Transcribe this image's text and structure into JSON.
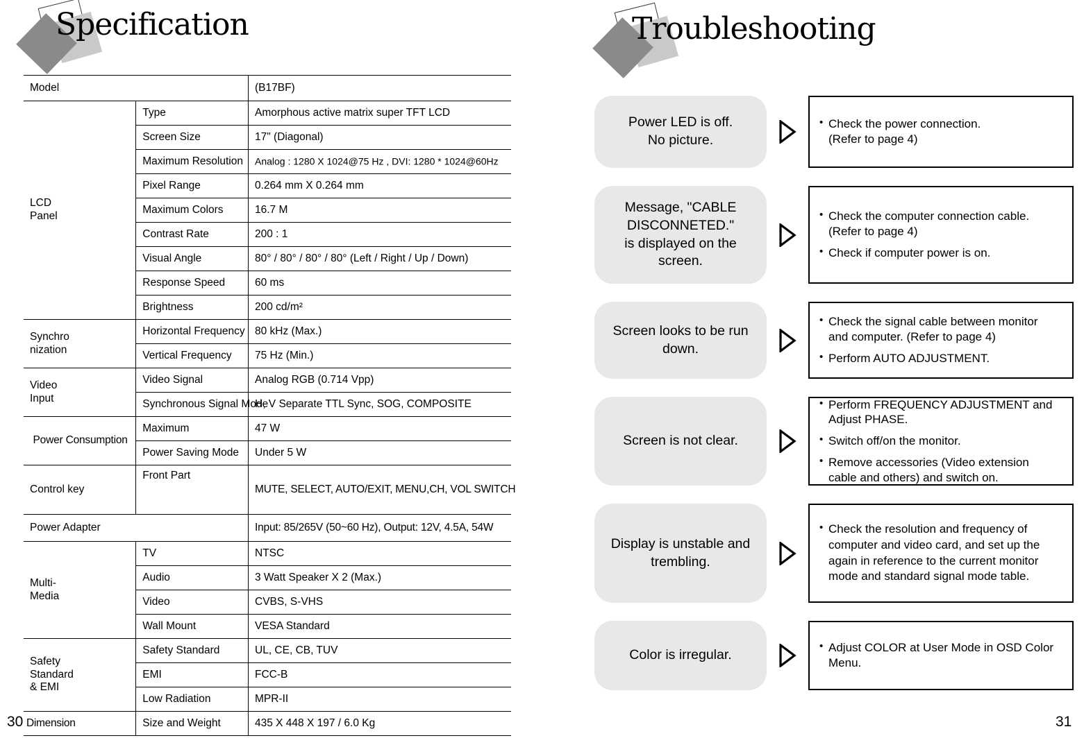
{
  "left_page": {
    "header_title": "Specification",
    "page_number": "30",
    "table": {
      "model_label": "Model",
      "model_value": "(B17BF)",
      "groups": [
        {
          "name": "LCD\nPanel",
          "rows": [
            {
              "key": "Type",
              "value": "Amorphous active matrix super TFT LCD"
            },
            {
              "key": "Screen Size",
              "value": "17\" (Diagonal)"
            },
            {
              "key": "Maximum Resolution",
              "value": "Analog : 1280 X 1024@75 Hz , DVI: 1280 * 1024@60Hz"
            },
            {
              "key": "Pixel Range",
              "value": "0.264 mm X 0.264 mm"
            },
            {
              "key": "Maximum Colors",
              "value": "16.7 M"
            },
            {
              "key": "Contrast Rate",
              "value": "200 : 1"
            },
            {
              "key": "Visual Angle",
              "value": "80° / 80° / 80° / 80° (Left / Right / Up /  Down)"
            },
            {
              "key": "Response Speed",
              "value": "60 ms"
            },
            {
              "key": "Brightness",
              "value": "200 cd/m²"
            }
          ]
        },
        {
          "name": "Synchro\nnization",
          "rows": [
            {
              "key": "Horizontal Frequency",
              "value": "80 kHz (Max.)"
            },
            {
              "key": "Vertical Frequency",
              "value": "75 Hz (Min.)"
            }
          ]
        },
        {
          "name": "Video\nInput",
          "rows": [
            {
              "key": "Video Signal",
              "value": "Analog RGB (0.714 Vpp)"
            },
            {
              "key": "Synchronous Signal Mode",
              "value": "H, V Separate TTL Sync, SOG, COMPOSITE"
            }
          ]
        },
        {
          "name": "Power Consumption",
          "rows": [
            {
              "key": "Maximum",
              "value": "47 W"
            },
            {
              "key": "Power Saving Mode",
              "value": "Under 5 W"
            }
          ]
        },
        {
          "name": "Control key",
          "rows": [
            {
              "key": "Front Part",
              "value": "MUTE, SELECT, AUTO/EXIT, MENU,CH,\nVOL SWITCH"
            }
          ]
        },
        {
          "name": "Power Adapter",
          "rows": [
            {
              "key": "",
              "value": "Input: 85/265V (50~60 Hz), Output: 12V, 4.5A, 54W"
            }
          ]
        },
        {
          "name": "Multi-\nMedia",
          "rows": [
            {
              "key": "TV",
              "value": "NTSC"
            },
            {
              "key": "Audio",
              "value": "3 Watt Speaker X 2 (Max.)"
            },
            {
              "key": "Video",
              "value": "CVBS, S-VHS"
            },
            {
              "key": "Wall Mount",
              "value": "VESA Standard"
            }
          ]
        },
        {
          "name": "Safety\nStandard\n& EMI",
          "rows": [
            {
              "key": "Safety Standard",
              "value": "UL, CE, CB, TUV"
            },
            {
              "key": "EMI",
              "value": "FCC-B"
            },
            {
              "key": "Low Radiation",
              "value": "MPR-II"
            }
          ]
        },
        {
          "name": "Dimension",
          "rows": [
            {
              "key": "Size and Weight",
              "value": "435 X 448 X 197 / 6.0 Kg"
            }
          ]
        }
      ]
    }
  },
  "right_page": {
    "header_title": "Troubleshooting",
    "page_number": "31",
    "items": [
      {
        "symptom": "Power LED is off.\nNo picture.",
        "solutions": [
          "Check the power connection.\n(Refer to page 4)"
        ]
      },
      {
        "symptom": "Message, \"CABLE\nDISCONNETED.\"\nis displayed on the\nscreen.",
        "solutions": [
          "Check the computer connection cable.\n(Refer to page 4)",
          "Check if computer power is on."
        ]
      },
      {
        "symptom": "Screen looks to be run\ndown.",
        "solutions": [
          "Check the signal cable between monitor\nand computer. (Refer to page 4)",
          "Perform AUTO ADJUSTMENT."
        ]
      },
      {
        "symptom": "Screen is not clear.",
        "solutions": [
          "Perform FREQUENCY ADJUSTMENT and\nAdjust PHASE.",
          "Switch off/on the monitor.",
          "Remove accessories (Video extension\ncable and others) and switch on."
        ]
      },
      {
        "symptom": "Display is unstable and\ntrembling.",
        "solutions": [
          "Check the resolution and frequency of\ncomputer and video card, and set up the\nagain in reference to the current monitor\nmode and standard signal mode table."
        ]
      },
      {
        "symptom": "Color is irregular.",
        "solutions": [
          "Adjust COLOR at User Mode in OSD Color\nMenu."
        ]
      }
    ]
  },
  "colors": {
    "symptom_box_fill": "#e8e8e8",
    "logo_dark": "#8a8a8a",
    "logo_light": "#c9c9c9",
    "rule": "#000000"
  }
}
